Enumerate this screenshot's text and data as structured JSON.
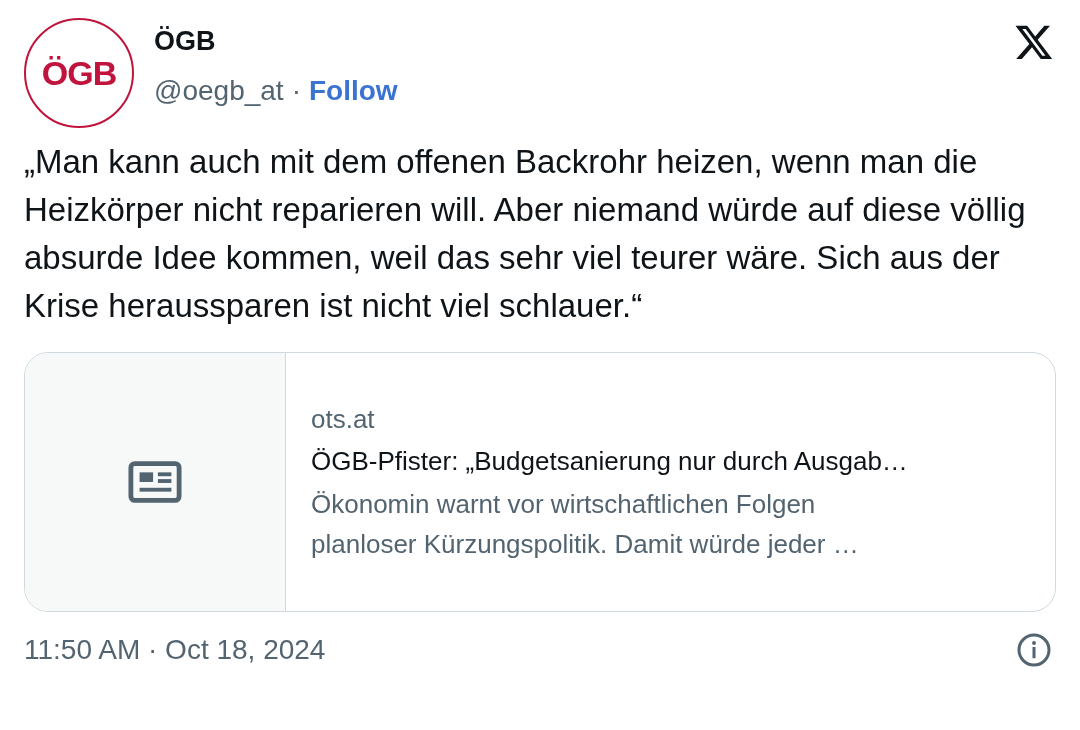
{
  "author": {
    "avatar_text": "ÖGB",
    "name": "ÖGB",
    "handle": "@oegb_at",
    "separator": "·",
    "follow": "Follow"
  },
  "text": "„Man kann auch mit dem offenen Backrohr heizen, wenn man die Heizkörper nicht reparieren will. Aber niemand würde auf diese völlig absurde Idee kommen, weil das sehr viel teurer wäre. Sich aus der Krise heraussparen ist nicht viel schlauer.“",
  "card": {
    "domain": "ots.at",
    "title": "ÖGB-Pfister: „Budgetsanierung nur durch Ausgab…",
    "description": "Ökonomin warnt vor wirtschaftlichen Folgen\nplanloser Kürzungspolitik. Damit würde jeder …"
  },
  "timestamp": "11:50 AM · Oct 18, 2024"
}
